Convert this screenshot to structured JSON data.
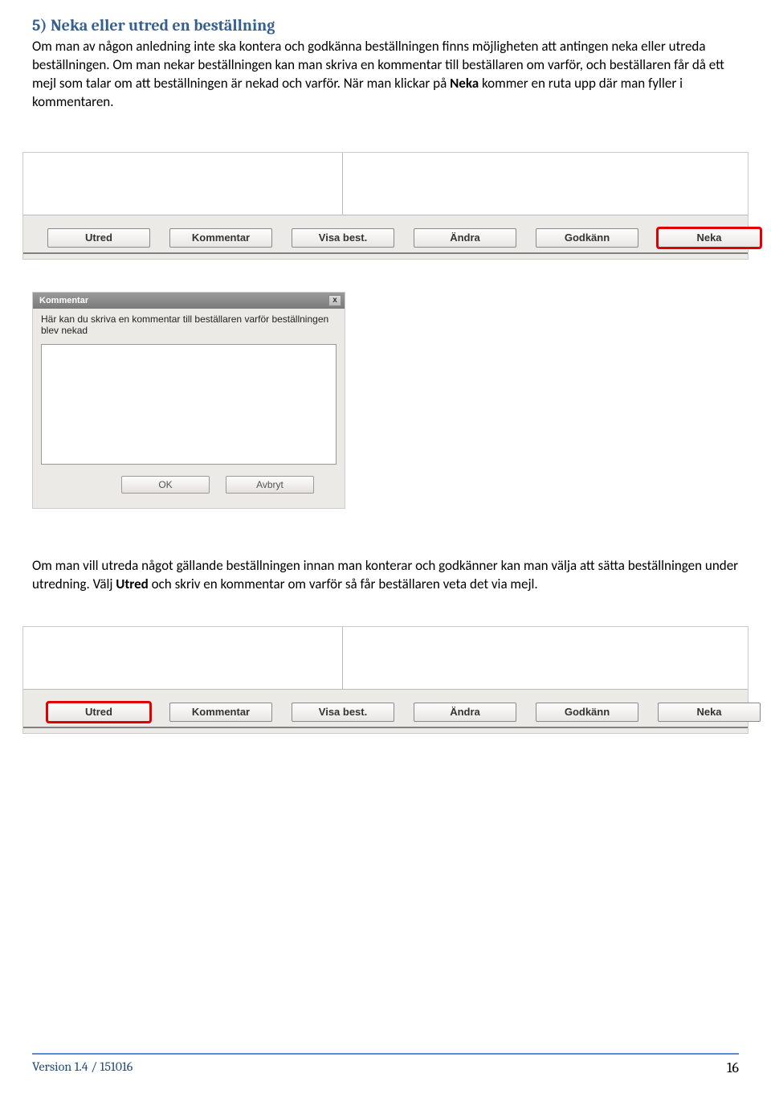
{
  "heading": "5)  Neka eller utred en beställning",
  "para1a": "Om man av någon anledning inte ska kontera och godkänna beställningen finns möjligheten att antingen neka eller utreda beställningen. Om man nekar beställningen kan man skriva en kommentar till beställaren om varför, och beställaren får då ett mejl som talar om att beställningen är nekad och varför. När man klickar på ",
  "para1_bold": "Neka",
  "para1b": " kommer en ruta upp där man fyller i kommentaren.",
  "buttons": {
    "utred": "Utred",
    "kommentar": "Kommentar",
    "visa": "Visa best.",
    "andra": "Ändra",
    "godkann": "Godkänn",
    "neka": "Neka"
  },
  "dialog": {
    "title": "Kommentar",
    "desc": "Här kan du skriva en kommentar till beställaren varför beställningen blev nekad",
    "ok": "OK",
    "cancel": "Avbryt"
  },
  "para2a": "Om man vill utreda något gällande beställningen innan man konterar och godkänner kan man välja att sätta beställningen under utredning. Välj ",
  "para2_bold": "Utred",
  "para2b": " och skriv en kommentar om varför så får beställaren veta det via mejl.",
  "footer": {
    "version": "Version 1.4 / 151016",
    "page": "16"
  }
}
